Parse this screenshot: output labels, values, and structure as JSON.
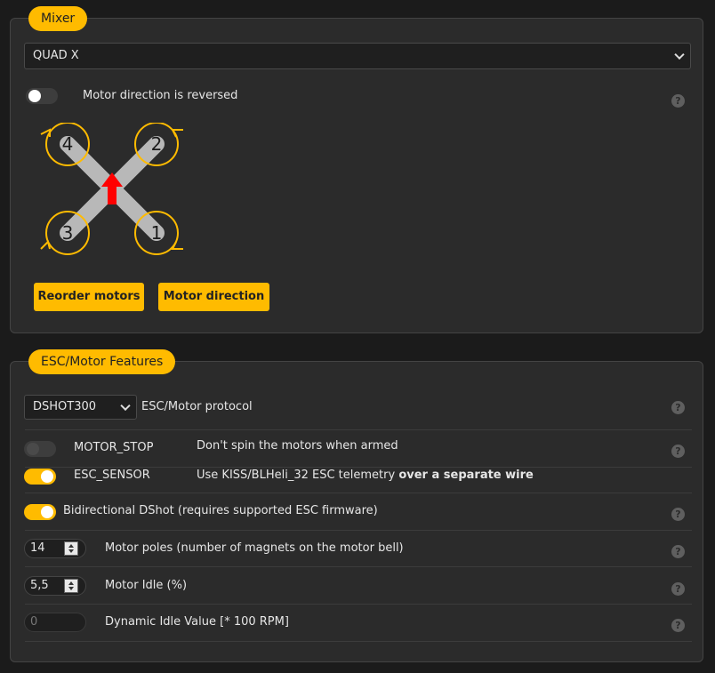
{
  "mixer": {
    "title": "Mixer",
    "selected": "QUAD X",
    "reversed_label": "Motor direction is reversed",
    "reversed_on": false,
    "motor_labels": [
      "4",
      "2",
      "3",
      "1"
    ],
    "reorder_label": "Reorder motors",
    "direction_label": "Motor direction"
  },
  "esc": {
    "title": "ESC/Motor Features",
    "protocol_value": "DSHOT300",
    "protocol_label": "ESC/Motor protocol",
    "motor_stop": {
      "name": "MOTOR_STOP",
      "desc": "Don't spin the motors when armed",
      "on": false
    },
    "esc_sensor": {
      "name": "ESC_SENSOR",
      "desc": "Use KISS/BLHeli_32 ESC telemetry ",
      "desc_bold": "over a separate wire",
      "on": true
    },
    "bidir": {
      "label": "Bidirectional DShot (requires supported ESC firmware)",
      "on": true
    },
    "poles": {
      "value": "14",
      "label": "Motor poles (number of magnets on the motor bell)"
    },
    "idle": {
      "value": "5,5",
      "label": "Motor Idle (%)"
    },
    "dyn_idle": {
      "value": "0",
      "label": "Dynamic Idle Value [* 100 RPM]"
    }
  },
  "help_glyph": "?",
  "colors": {
    "accent": "#ffbb00",
    "panel": "#2b2b2b",
    "arrow": "#ff0000",
    "arm": "#b8b8b8"
  }
}
